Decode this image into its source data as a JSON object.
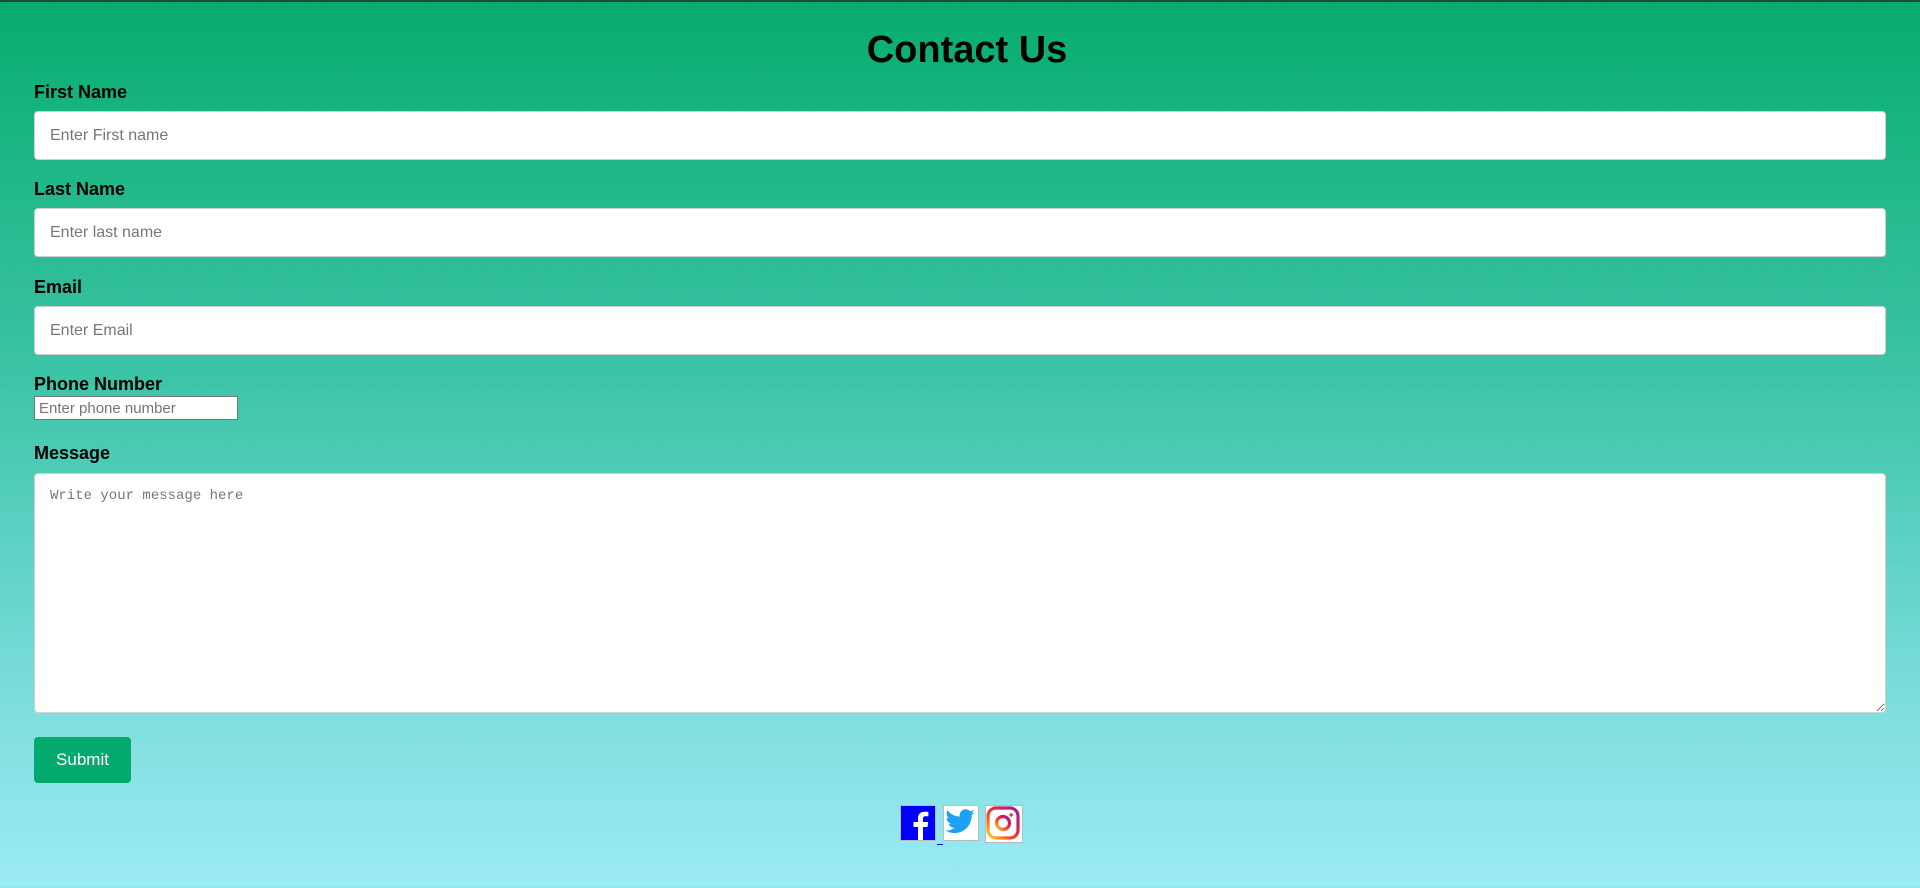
{
  "page": {
    "title": "Contact Us"
  },
  "form": {
    "first_name": {
      "label": "First Name",
      "placeholder": "Enter First name",
      "value": ""
    },
    "last_name": {
      "label": "Last Name",
      "placeholder": "Enter last name",
      "value": ""
    },
    "email": {
      "label": "Email",
      "placeholder": "Enter Email",
      "value": ""
    },
    "phone": {
      "label": "Phone Number",
      "placeholder": "Enter phone number",
      "value": ""
    },
    "message": {
      "label": "Message",
      "placeholder": "Write your message here",
      "value": ""
    },
    "submit_label": "Submit"
  },
  "social": {
    "icons": [
      "facebook-icon",
      "twitter-icon",
      "instagram-icon"
    ]
  },
  "colors": {
    "gradient_top": "#06ac6e",
    "gradient_bottom": "#9aeaf6",
    "button": "#04aa6d",
    "facebook": "#0000ff",
    "twitter": "#1da1f2"
  }
}
